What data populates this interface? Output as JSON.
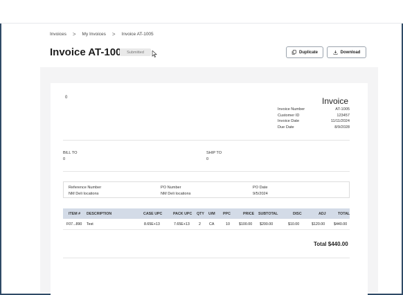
{
  "breadcrumb": [
    "Invoices",
    "My Invoices",
    "Invoice AT-1005"
  ],
  "breadcrumb_separator": ">",
  "page_title": "Invoice AT-1005",
  "status_badge": "Submitted",
  "buttons": {
    "duplicate": "Duplicate",
    "download": "Download"
  },
  "doc": {
    "from_line": "0",
    "heading": "Invoice",
    "meta": [
      {
        "label": "Invoice Number",
        "value": "AT-1005"
      },
      {
        "label": "Customer ID",
        "value": "123457"
      },
      {
        "label": "Invoice Date",
        "value": "11/11/2024"
      },
      {
        "label": "Due Date",
        "value": "8/9/2028"
      }
    ],
    "bill_to": {
      "label": "BILL TO",
      "value": "0"
    },
    "ship_to": {
      "label": "SHIP TO",
      "value": "0"
    },
    "reference": {
      "reference_number": {
        "label": "Reference Number",
        "value": "NM Deli locations"
      },
      "po_number": {
        "label": "PO Number",
        "value": "NM Deli locations"
      },
      "po_date": {
        "label": "PO Date",
        "value": "9/5/2024"
      }
    },
    "table": {
      "headers": [
        "ITEM #",
        "DESCRIPTION",
        "CASE UPC",
        "PACK UPC",
        "QTY",
        "U/M",
        "PPC",
        "PRICE",
        "SUBTOTAL",
        "DISC",
        "ADJ",
        "TOTAL"
      ],
      "rows": [
        [
          "F07...890",
          "Test",
          "8.65E+13",
          "7.65E+13",
          "2",
          "CA",
          "10",
          "$100.00",
          "$200.00",
          "$10.00",
          "$120.00",
          "$440.00"
        ]
      ]
    },
    "total_line": "Total $440.00"
  },
  "colors": {
    "table_header_bg": "#d3dbe7",
    "frame_border": "#2f4a66",
    "page_bg": "#f4f4f5"
  }
}
